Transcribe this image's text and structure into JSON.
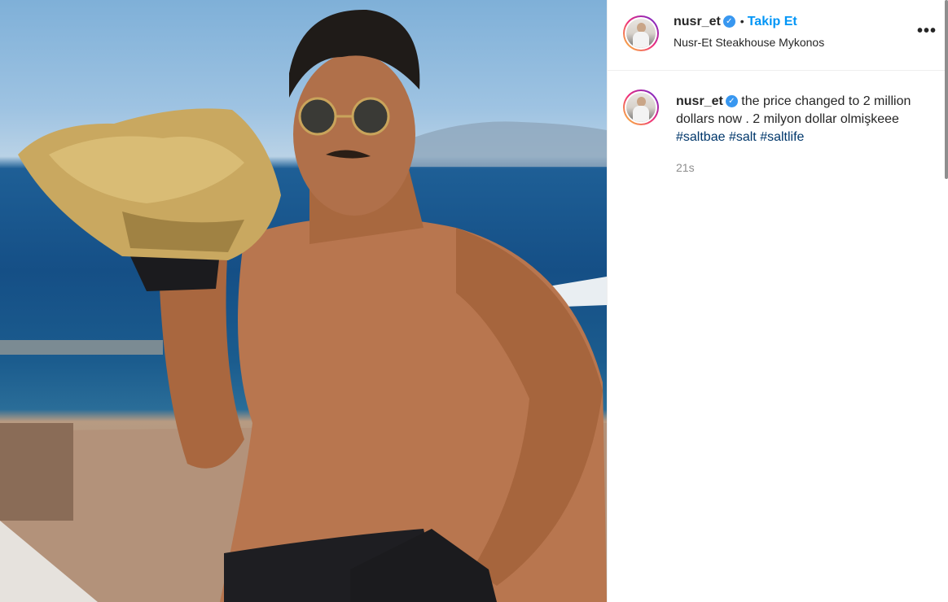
{
  "post": {
    "username": "nusr_et",
    "follow_label": "Takip Et",
    "separator": "•",
    "location": "Nusr-Et Steakhouse Mykonos",
    "more_label": "•••",
    "verified_icon": "verified-check-icon"
  },
  "comment": {
    "username": "nusr_et",
    "text": "the price changed to 2 million dollars now . 2 milyon dollar olmişkeee",
    "hashtags": [
      "#saltbae",
      "#salt",
      "#saltlife"
    ],
    "time": "21s"
  },
  "colors": {
    "link_blue": "#0095f6",
    "hashtag": "#00376b",
    "verified": "#3897f0"
  }
}
